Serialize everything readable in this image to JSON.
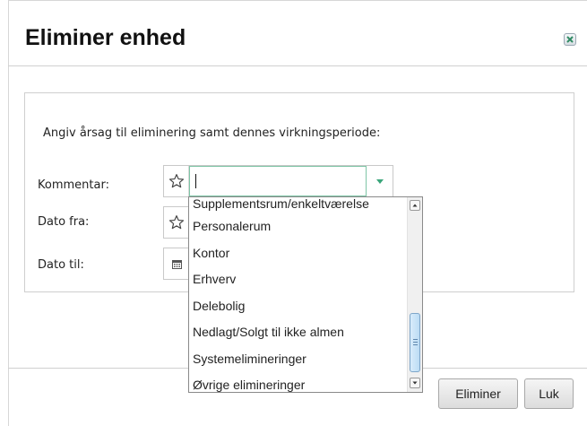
{
  "dialog": {
    "title": "Eliminer enhed",
    "instruction": "Angiv årsag til eliminering samt dennes virkningsperiode:"
  },
  "form": {
    "comment_label": "Kommentar:",
    "comment_value": "",
    "date_from_label": "Dato fra:",
    "date_to_label": "Dato til:"
  },
  "dropdown": {
    "items": [
      "Supplementsrum/enkeltværelse",
      "Personalerum",
      "Kontor",
      "Erhverv",
      "Delebolig",
      "Nedlagt/Solgt til ikke almen",
      "Systemelimineringer",
      "Øvrige elimineringer"
    ]
  },
  "footer": {
    "eliminate_label": "Eliminer",
    "close_label": "Luk"
  },
  "colors": {
    "accent_green": "#3aa57a",
    "input_focus_border": "#7ec5a6",
    "scroll_thumb": "#bcdcf4"
  },
  "icons": {
    "close": "close-icon",
    "favorite": "star-outline-icon",
    "dropdown": "caret-down-icon",
    "calendar": "calendar-icon"
  }
}
